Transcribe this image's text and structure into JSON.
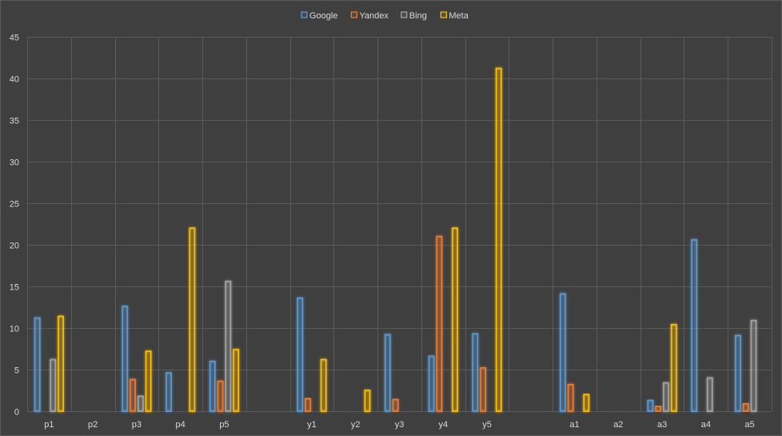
{
  "chart_data": {
    "type": "bar",
    "categories": [
      "p1",
      "p2",
      "p3",
      "p4",
      "p5",
      "",
      "y1",
      "y2",
      "y3",
      "y4",
      "y5",
      "",
      "a1",
      "a2",
      "a3",
      "a4",
      "a5"
    ],
    "series": [
      {
        "name": "Google",
        "color": "#5b9bd5",
        "values": [
          11.2,
          0,
          12.6,
          4.6,
          6.0,
          0,
          13.6,
          0,
          9.2,
          6.6,
          9.3,
          0,
          14.1,
          0,
          1.3,
          20.6,
          9.1
        ]
      },
      {
        "name": "Yandex",
        "color": "#ed7d31",
        "values": [
          0,
          0,
          3.8,
          0,
          3.6,
          0,
          1.5,
          0,
          1.4,
          21.0,
          5.2,
          0,
          3.2,
          0,
          0.6,
          0,
          0.9
        ]
      },
      {
        "name": "Bing",
        "color": "#a5a5a5",
        "values": [
          6.2,
          0,
          1.8,
          0,
          15.6,
          0,
          0,
          0,
          0,
          0,
          0,
          0,
          0,
          0,
          3.4,
          4.0,
          10.9
        ]
      },
      {
        "name": "Meta",
        "color": "#ffc000",
        "values": [
          11.4,
          0,
          7.2,
          22.0,
          7.4,
          0,
          6.2,
          2.5,
          0,
          22.0,
          41.2,
          0,
          2.0,
          0,
          10.4,
          0,
          0
        ]
      }
    ],
    "ylim": [
      0,
      45
    ],
    "yticks": [
      0,
      5,
      10,
      15,
      20,
      25,
      30,
      35,
      40,
      45
    ],
    "grid": true,
    "legend_position": "top"
  }
}
